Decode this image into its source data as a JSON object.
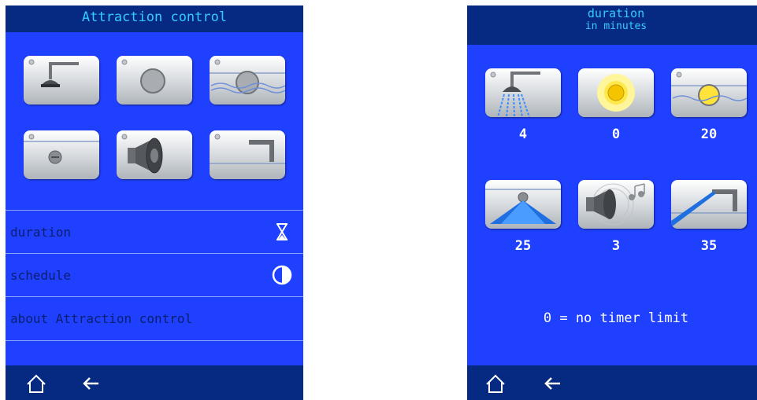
{
  "left": {
    "title": "Attraction control",
    "tiles": [
      {
        "icon": "shower-head-icon"
      },
      {
        "icon": "light-icon"
      },
      {
        "icon": "pool-light-icon"
      },
      {
        "icon": "jet-icon"
      },
      {
        "icon": "speaker-icon"
      },
      {
        "icon": "water-spout-icon"
      }
    ],
    "menu": [
      {
        "label": "duration",
        "icon": "hourglass-icon"
      },
      {
        "label": "schedule",
        "icon": "clock-icon"
      },
      {
        "label": "about Attraction control",
        "icon": ""
      }
    ]
  },
  "right": {
    "title": "duration",
    "subtitle": "in minutes",
    "tiles": [
      {
        "icon": "shower-head-active-icon",
        "value": "4"
      },
      {
        "icon": "light-on-icon",
        "value": "0"
      },
      {
        "icon": "pool-light-on-icon",
        "value": "20"
      },
      {
        "icon": "jet-active-icon",
        "value": "25"
      },
      {
        "icon": "speaker-playing-icon",
        "value": "3"
      },
      {
        "icon": "water-spout-active-icon",
        "value": "35"
      }
    ],
    "note": "0 = no timer limit"
  },
  "footer": {
    "home_icon": "home-icon",
    "back_icon": "back-arrow-icon"
  },
  "colors": {
    "background": "#1f40ff",
    "header": "#062a82",
    "title_text": "#33ccff",
    "menu_text": "#0b1f6e"
  }
}
